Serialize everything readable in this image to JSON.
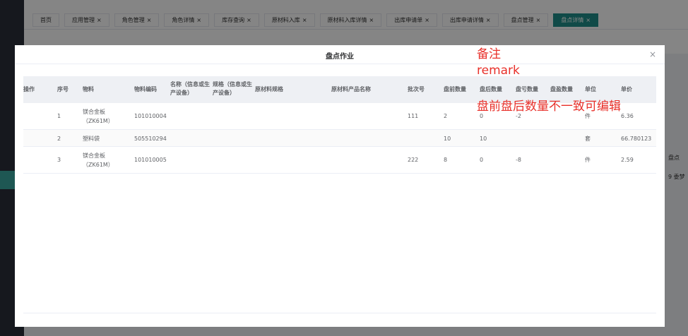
{
  "tabs": [
    {
      "label": "首页",
      "closable": false
    },
    {
      "label": "应用管理",
      "closable": true
    },
    {
      "label": "角色管理",
      "closable": true
    },
    {
      "label": "角色详情",
      "closable": true
    },
    {
      "label": "库存查询",
      "closable": true
    },
    {
      "label": "原材料入库",
      "closable": true
    },
    {
      "label": "原材料入库详情",
      "closable": true
    },
    {
      "label": "出库申请单",
      "closable": true
    },
    {
      "label": "出库申请详情",
      "closable": true
    },
    {
      "label": "盘点管理",
      "closable": true
    },
    {
      "label": "盘点详情",
      "closable": true,
      "active": true
    }
  ],
  "close_glyph": "×",
  "background_right": [
    "盘点",
    "9 委梦"
  ],
  "modal": {
    "title": "盘点作业",
    "close": "×"
  },
  "table": {
    "headers": [
      "操作",
      "序号",
      "物料",
      "物料编码",
      "名称（信息或生产设备）",
      "规格（信息或生产设备）",
      "原材料规格",
      "原材料产品名称",
      "批次号",
      "盘前数量",
      "盘后数量",
      "盘亏数量",
      "盘盈数量",
      "单位",
      "单价"
    ],
    "rows": [
      {
        "seq": "1",
        "material": "镁合金板（ZK61M）",
        "code": "101010004",
        "batch": "111",
        "before": "2",
        "after": "0",
        "loss": "-2",
        "gain": "",
        "unit": "件",
        "price": "6.36"
      },
      {
        "seq": "2",
        "material": "塑料袋",
        "code": "505510294",
        "batch": "",
        "before": "10",
        "after": "10",
        "loss": "",
        "gain": "",
        "unit": "套",
        "price": "66.780123"
      },
      {
        "seq": "3",
        "material": "镁合金板（ZK61M）",
        "code": "101010005",
        "batch": "222",
        "before": "8",
        "after": "0",
        "loss": "-8",
        "gain": "",
        "unit": "件",
        "price": "2.59"
      }
    ]
  },
  "annotation": {
    "line1": "备注",
    "line2": "remark",
    "line3": "盘前盘后数量不一致可编辑"
  },
  "colors": {
    "accent": "#1f8f8a",
    "annotation": "#e8302a",
    "header_bg": "#eef0f4"
  }
}
